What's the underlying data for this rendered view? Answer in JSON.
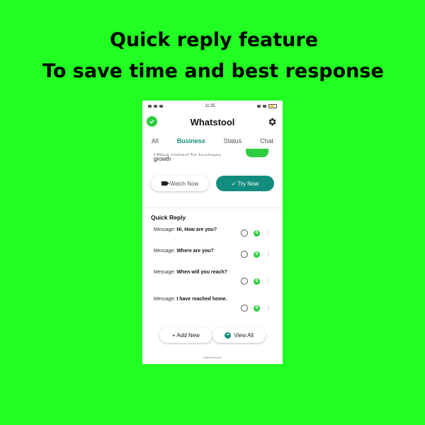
{
  "headline": {
    "line1": "Quick reply feature",
    "line2": "To save time and best response"
  },
  "status_bar": {
    "time": "11:35"
  },
  "app": {
    "title": "Whatstool"
  },
  "tabs": [
    {
      "label": "All"
    },
    {
      "label": "Business"
    },
    {
      "label": "Status"
    },
    {
      "label": "Chat"
    }
  ],
  "promo": {
    "text_line1": "Utilise contact for business",
    "text_line2": "growth",
    "watch_label": "Watch Now",
    "try_label": "✓ Try Now"
  },
  "quick_reply": {
    "title": "Quick Reply",
    "items": [
      {
        "prefix": "Message:",
        "text": "Hi, How are you?"
      },
      {
        "prefix": "Message:",
        "text": "Where are you?"
      },
      {
        "prefix": "Message:",
        "text": "When will you reach?"
      },
      {
        "prefix": "Message:",
        "text": "I have reached home."
      }
    ],
    "add_label": "+ Add New",
    "view_label": "View All"
  },
  "colors": {
    "background": "#22ff22",
    "accent": "#128c7e",
    "green": "#2ecc40"
  }
}
